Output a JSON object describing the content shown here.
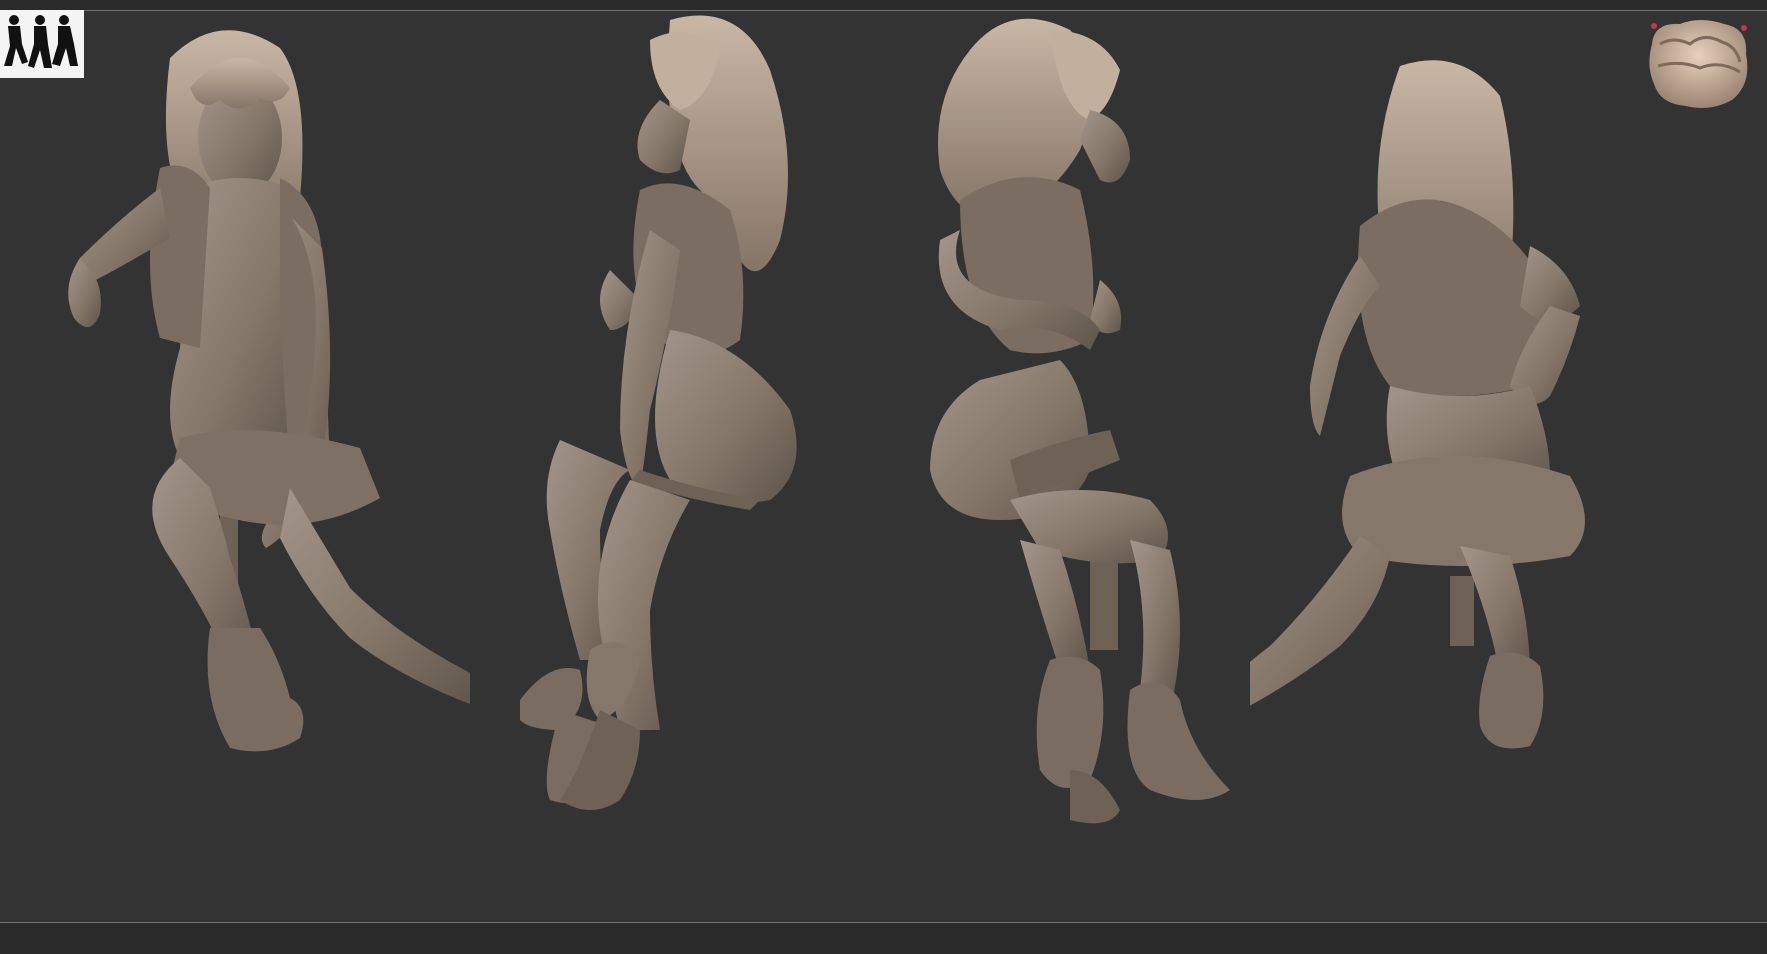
{
  "viewport": {
    "background": "#333334",
    "clay_color": "#8a7c6f"
  },
  "thumbnail": {
    "icon": "silhouettes-icon"
  },
  "navigator": {
    "icon": "head-navigator-icon"
  },
  "views": [
    {
      "name": "front-view"
    },
    {
      "name": "right-side-view"
    },
    {
      "name": "left-side-view"
    },
    {
      "name": "back-view"
    }
  ]
}
